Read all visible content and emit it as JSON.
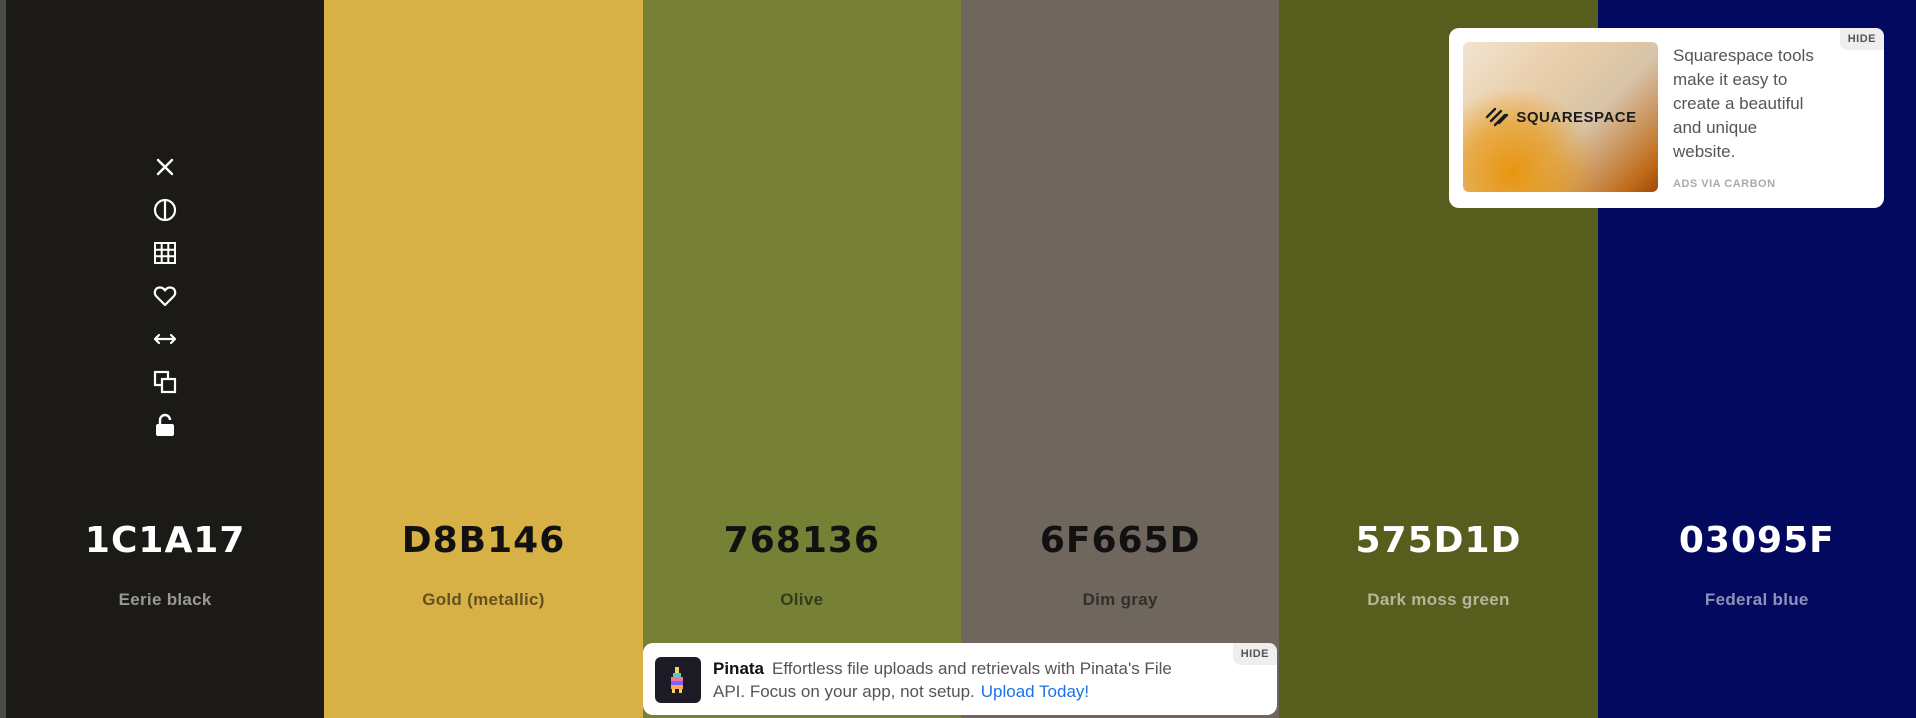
{
  "palette": [
    {
      "hex": "1C1A17",
      "name": "Eerie black",
      "color": "#1c1a17",
      "tone": "light"
    },
    {
      "hex": "D8B146",
      "name": "Gold (metallic)",
      "color": "#d8b146",
      "tone": "dark"
    },
    {
      "hex": "768136",
      "name": "Olive",
      "color": "#768136",
      "tone": "dark"
    },
    {
      "hex": "6F665D",
      "name": "Dim gray",
      "color": "#6f665d",
      "tone": "dark"
    },
    {
      "hex": "575D1D",
      "name": "Dark moss green",
      "color": "#575d1d",
      "tone": "light"
    },
    {
      "hex": "03095F",
      "name": "Federal blue",
      "color": "#03095f",
      "tone": "light"
    }
  ],
  "swatch_tools": [
    "close-icon",
    "contrast-icon",
    "shades-grid-icon",
    "heart-icon",
    "drag-arrows-icon",
    "copy-icon",
    "unlock-icon"
  ],
  "carbon_ad": {
    "brand": "SQUARESPACE",
    "text": "Squarespace tools make it easy to create a beautiful and unique website.",
    "via": "ADS VIA CARBON",
    "hide": "HIDE"
  },
  "pinata_ad": {
    "title": "Pinata",
    "text": "Effortless file uploads and retrievals with Pinata's File API. Focus on your app, not setup.",
    "link": "Upload Today!",
    "hide": "HIDE"
  }
}
